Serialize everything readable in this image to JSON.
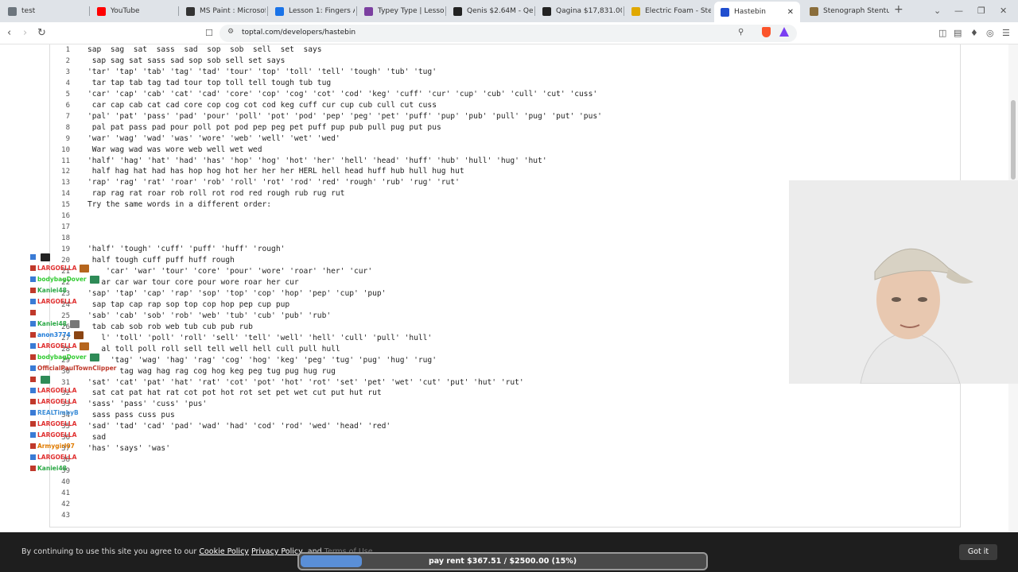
{
  "browser": {
    "tabs": [
      {
        "title": "test",
        "icon": "globe-icon",
        "color": "#6c757d"
      },
      {
        "title": "YouTube",
        "icon": "youtube-icon",
        "color": "#ff0000"
      },
      {
        "title": "MS Paint : Microsoft P",
        "icon": "paint-icon",
        "color": "#333333"
      },
      {
        "title": "Lesson 1: Fingers And",
        "icon": "lesson-icon",
        "color": "#1a73e8"
      },
      {
        "title": "Typey Type | Lesson: C",
        "icon": "keyboard-icon",
        "color": "#7b3fa0"
      },
      {
        "title": "Qenis $2.64M - Qeni",
        "icon": "app-icon",
        "color": "#222222"
      },
      {
        "title": "Qagina $17,831.00 - Q",
        "icon": "app-icon",
        "color": "#222222"
      },
      {
        "title": "Electric Foam - Steno",
        "icon": "cloud-icon",
        "color": "#e0a800"
      },
      {
        "title": "Hastebin",
        "icon": "toptal-icon",
        "color": "#204ecf"
      },
      {
        "title": "Stenograph Stentura 2",
        "icon": "shop-icon",
        "color": "#8a6d3b"
      }
    ],
    "url": "toptal.com/developers/hastebin"
  },
  "editor": {
    "lines": [
      {
        "n": "1",
        "text": "sap  sag  sat  sass  sad  sop  sob  sell  set  says"
      },
      {
        "n": "2",
        "text": " sap sag sat sass sad sop sob sell set says"
      },
      {
        "n": "3",
        "text": "'tar' 'tap' 'tab' 'tag' 'tad' 'tour' 'top' 'toll' 'tell' 'tough' 'tub' 'tug'"
      },
      {
        "n": "4",
        "text": " tar tap tab tag tad tour top toll tell tough tub tug"
      },
      {
        "n": "5",
        "text": "'car' 'cap' 'cab' 'cat' 'cad' 'core' 'cop' 'cog' 'cot' 'cod' 'keg' 'cuff' 'cur' 'cup' 'cub' 'cull' 'cut' 'cuss'"
      },
      {
        "n": "6",
        "text": " car cap cab cat cad core cop cog cot cod keg cuff cur cup cub cull cut cuss"
      },
      {
        "n": "7",
        "text": "'pal' 'pat' 'pass' 'pad' 'pour' 'poll' 'pot' 'pod' 'pep' 'peg' 'pet' 'puff' 'pup' 'pub' 'pull' 'pug' 'put' 'pus'"
      },
      {
        "n": "8",
        "text": " pal pat pass pad pour poll pot pod pep peg pet puff pup pub pull pug put pus"
      },
      {
        "n": "9",
        "text": "'war' 'wag' 'wad' 'was' 'wore' 'web' 'well' 'wet' 'wed'"
      },
      {
        "n": "10",
        "text": " War wag wad was wore web well wet wed"
      },
      {
        "n": "11",
        "text": "'half' 'hag' 'hat' 'had' 'has' 'hop' 'hog' 'hot' 'her' 'hell' 'head' 'huff' 'hub' 'hull' 'hug' 'hut'"
      },
      {
        "n": "12",
        "text": " half hag hat had has hop hog hot her her her HERL hell head huff hub hull hug hut"
      },
      {
        "n": "13",
        "text": "'rap' 'rag' 'rat' 'roar' 'rob' 'roll' 'rot' 'rod' 'red' 'rough' 'rub' 'rug' 'rut'"
      },
      {
        "n": "14",
        "text": " rap rag rat roar rob roll rot rod red rough rub rug rut"
      },
      {
        "n": "15",
        "text": "Try the same words in a different order:"
      },
      {
        "n": "16",
        "text": ""
      },
      {
        "n": "17",
        "text": ""
      },
      {
        "n": "18",
        "text": ""
      },
      {
        "n": "19",
        "text": "'half' 'tough' 'cuff' 'puff' 'huff' 'rough'"
      },
      {
        "n": "20",
        "text": " half tough cuff puff huff rough"
      },
      {
        "n": "21",
        "text": "    'car' 'war' 'tour' 'core' 'pour' 'wore' 'roar' 'her' 'cur'"
      },
      {
        "n": "22",
        "text": "   ar car war tour core pour wore roar her cur"
      },
      {
        "n": "23",
        "text": "'sap' 'tap' 'cap' 'rap' 'sop' 'top' 'cop' 'hop' 'pep' 'cup' 'pup'"
      },
      {
        "n": "24",
        "text": " sap tap cap rap sop top cop hop pep cup pup"
      },
      {
        "n": "25",
        "text": "'sab' 'cab' 'sob' 'rob' 'web' 'tub' 'cub' 'pub' 'rub'"
      },
      {
        "n": "26",
        "text": " tab cab sob rob web tub cub pub rub"
      },
      {
        "n": "27",
        "text": "   l' 'toll' 'poll' 'roll' 'sell' 'tell' 'well' 'hell' 'cull' 'pull' 'hull'"
      },
      {
        "n": "28",
        "text": "   al toll poll roll sell tell well hell cull pull hull"
      },
      {
        "n": "29",
        "text": "     'tag' 'wag' 'hag' 'rag' 'cog' 'hog' 'keg' 'peg' 'tug' 'pug' 'hug' 'rug'"
      },
      {
        "n": "30",
        "text": "       tag wag hag rag cog hog keg peg tug pug hug rug"
      },
      {
        "n": "31",
        "text": "'sat' 'cat' 'pat' 'hat' 'rat' 'cot' 'pot' 'hot' 'rot' 'set' 'pet' 'wet' 'cut' 'put' 'hut' 'rut'"
      },
      {
        "n": "32",
        "text": " sat cat pat hat rat cot pot hot rot set pet wet cut put hut rut"
      },
      {
        "n": "33",
        "text": "'sass' 'pass' 'cuss' 'pus'"
      },
      {
        "n": "34",
        "text": " sass pass cuss pus"
      },
      {
        "n": "35",
        "text": "'sad' 'tad' 'cad' 'pad' 'wad' 'had' 'cod' 'rod' 'wed' 'head' 'red'"
      },
      {
        "n": "36",
        "text": " sad"
      },
      {
        "n": "37",
        "text": "'has' 'says' 'was'"
      },
      {
        "n": "38",
        "text": ""
      },
      {
        "n": "39",
        "text": ""
      },
      {
        "n": "40",
        "text": ""
      },
      {
        "n": "41",
        "text": ""
      },
      {
        "n": "42",
        "text": ""
      },
      {
        "n": "43",
        "text": ""
      }
    ]
  },
  "chat": {
    "messages": [
      {
        "user": "",
        "color": "#22aa22",
        "thumb": "#222222"
      },
      {
        "user": "LARGOELLA",
        "color": "#e03030",
        "thumb": "#b5651d"
      },
      {
        "user": "bodybagDover",
        "color": "#33cc33",
        "thumb": "#2e8b57"
      },
      {
        "user": "Kaniei48",
        "color": "#2aa845",
        "thumb": ""
      },
      {
        "user": "LARGOELLA",
        "color": "#e03030",
        "thumb": ""
      },
      {
        "user": "",
        "color": "#999999",
        "thumb": ""
      },
      {
        "user": "Kaniei48",
        "color": "#2aa845",
        "thumb": "#777777"
      },
      {
        "user": "anon3774",
        "color": "#1e7bd8",
        "thumb": "#8b4513"
      },
      {
        "user": "LARGOELLA",
        "color": "#e03030",
        "thumb": "#b5651d"
      },
      {
        "user": "bodybagDover",
        "color": "#33cc33",
        "thumb": "#2e8b57"
      },
      {
        "user": "OfficialPaulTownClipper",
        "color": "#c0392b",
        "thumb": ""
      },
      {
        "user": "",
        "color": "#2aa845",
        "thumb": "#2e8b57"
      },
      {
        "user": "LARGOELLA",
        "color": "#e03030",
        "thumb": ""
      },
      {
        "user": "LARGOELLA",
        "color": "#e03030",
        "thumb": ""
      },
      {
        "user": "REALTimbyB",
        "color": "#3f8fd8",
        "thumb": ""
      },
      {
        "user": "LARGOELLA",
        "color": "#e03030",
        "thumb": ""
      },
      {
        "user": "LARGOELLA",
        "color": "#e03030",
        "thumb": ""
      },
      {
        "user": "Armygirl07",
        "color": "#e07b00",
        "thumb": ""
      },
      {
        "user": "LARGOELLA",
        "color": "#e03030",
        "thumb": ""
      },
      {
        "user": "Kaniei48",
        "color": "#2aa845",
        "thumb": ""
      }
    ]
  },
  "cookie": {
    "prefix": "By continuing to use this site you agree to our",
    "cookie_policy": "Cookie Policy",
    "privacy_policy": "Privacy Policy",
    "suffix": ", and",
    "terms": "Terms of Use",
    "button": "Got it"
  },
  "goal": {
    "text": "pay rent $367.51 / $2500.00 (15%)",
    "progress": 0.15
  }
}
